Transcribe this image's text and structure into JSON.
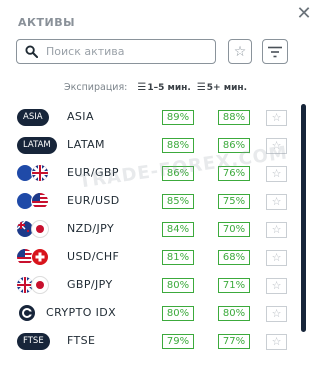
{
  "header": {
    "title": "АКТИВЫ",
    "close_icon": "close-icon"
  },
  "search": {
    "placeholder": "Поиск актива"
  },
  "expiry": {
    "label": "Экспирация:",
    "option1": "1–5 мин.",
    "option2": "5+ мин."
  },
  "watermark": "TRADE-FOREX.COM",
  "colors": {
    "accent_green": "#3caa3c",
    "pill_bg": "#17253a"
  },
  "assets": [
    {
      "name": "ASIA",
      "badge": "ASIA",
      "p1": "89%",
      "p2": "88%"
    },
    {
      "name": "LATAM",
      "badge": "LATAM",
      "p1": "88%",
      "p2": "86%"
    },
    {
      "name": "EUR/GBP",
      "badge": "",
      "p1": "86%",
      "p2": "76%"
    },
    {
      "name": "EUR/USD",
      "badge": "",
      "p1": "85%",
      "p2": "75%"
    },
    {
      "name": "NZD/JPY",
      "badge": "",
      "p1": "84%",
      "p2": "70%"
    },
    {
      "name": "USD/CHF",
      "badge": "",
      "p1": "81%",
      "p2": "68%"
    },
    {
      "name": "GBP/JPY",
      "badge": "",
      "p1": "80%",
      "p2": "71%"
    },
    {
      "name": "CRYPTO IDX",
      "badge": "",
      "p1": "80%",
      "p2": "80%"
    },
    {
      "name": "FTSE",
      "badge": "FTSE",
      "p1": "79%",
      "p2": "77%"
    }
  ]
}
